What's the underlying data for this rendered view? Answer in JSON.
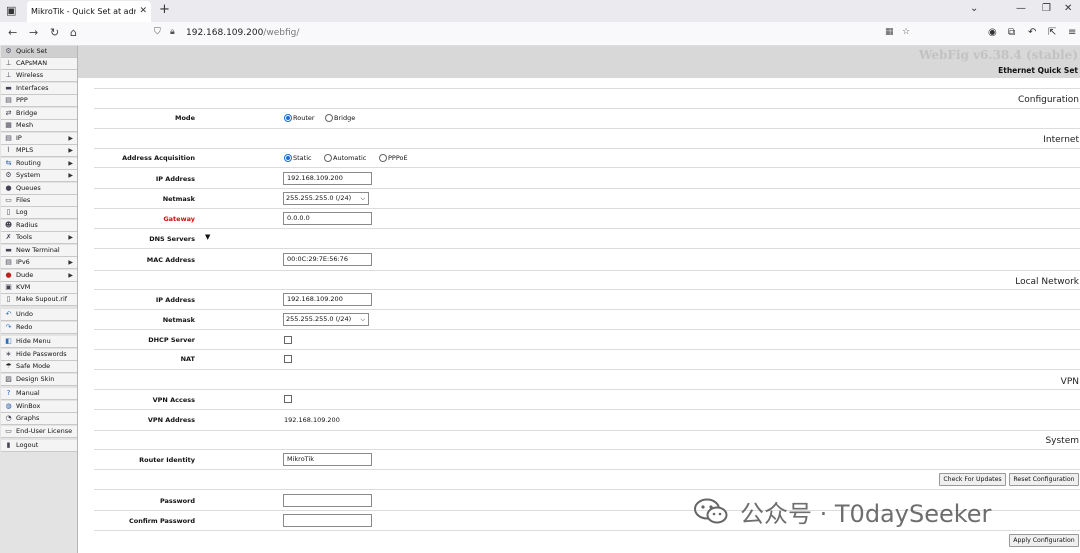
{
  "browser": {
    "tab_title": "MikroTik - Quick Set at admin@",
    "url_host": "192.168.109.200",
    "url_path": "/webfig/"
  },
  "sidebar": {
    "items": [
      {
        "label": "Quick Set",
        "icon": "quickset-icon",
        "arrow": false
      },
      {
        "label": "CAPsMAN",
        "icon": "capsman-icon",
        "arrow": false
      },
      {
        "label": "Wireless",
        "icon": "wireless-icon",
        "arrow": false
      },
      {
        "label": "Interfaces",
        "icon": "interfaces-icon",
        "arrow": false
      },
      {
        "label": "PPP",
        "icon": "ppp-icon",
        "arrow": false
      },
      {
        "label": "Bridge",
        "icon": "bridge-icon",
        "arrow": false
      },
      {
        "label": "Mesh",
        "icon": "mesh-icon",
        "arrow": false
      },
      {
        "label": "IP",
        "icon": "ip-icon",
        "arrow": true
      },
      {
        "label": "MPLS",
        "icon": "mpls-icon",
        "arrow": true
      },
      {
        "label": "Routing",
        "icon": "routing-icon",
        "arrow": true
      },
      {
        "label": "System",
        "icon": "system-icon",
        "arrow": true
      },
      {
        "label": "Queues",
        "icon": "queues-icon",
        "arrow": false
      },
      {
        "label": "Files",
        "icon": "files-icon",
        "arrow": false
      },
      {
        "label": "Log",
        "icon": "log-icon",
        "arrow": false
      },
      {
        "label": "Radius",
        "icon": "radius-icon",
        "arrow": false
      },
      {
        "label": "Tools",
        "icon": "tools-icon",
        "arrow": true
      },
      {
        "label": "New Terminal",
        "icon": "terminal-icon",
        "arrow": false
      },
      {
        "label": "IPv6",
        "icon": "ipv6-icon",
        "arrow": true
      },
      {
        "label": "Dude",
        "icon": "dude-icon",
        "arrow": true
      },
      {
        "label": "KVM",
        "icon": "kvm-icon",
        "arrow": false
      },
      {
        "label": "Make Supout.rif",
        "icon": "supout-icon",
        "arrow": false
      },
      {
        "label": "Undo",
        "icon": "undo-icon",
        "arrow": false
      },
      {
        "label": "Redo",
        "icon": "redo-icon",
        "arrow": false
      },
      {
        "label": "Hide Menu",
        "icon": "hide-menu-icon",
        "arrow": false
      },
      {
        "label": "Hide Passwords",
        "icon": "hide-passwords-icon",
        "arrow": false
      },
      {
        "label": "Safe Mode",
        "icon": "safe-mode-icon",
        "arrow": false
      },
      {
        "label": "Design Skin",
        "icon": "design-skin-icon",
        "arrow": false
      },
      {
        "label": "Manual",
        "icon": "manual-icon",
        "arrow": false
      },
      {
        "label": "WinBox",
        "icon": "winbox-icon",
        "arrow": false
      },
      {
        "label": "Graphs",
        "icon": "graphs-icon",
        "arrow": false
      },
      {
        "label": "End-User License",
        "icon": "license-icon",
        "arrow": false
      },
      {
        "label": "Logout",
        "icon": "logout-icon",
        "arrow": false
      }
    ]
  },
  "header": {
    "brand": "WebFig v6.38.4 (stable)",
    "title": "Ethernet Quick Set"
  },
  "sections": {
    "configuration": "Configuration",
    "internet": "Internet",
    "local_network": "Local Network",
    "vpn": "VPN",
    "system": "System"
  },
  "config": {
    "mode_label": "Mode",
    "mode_options": [
      "Router",
      "Bridge"
    ],
    "mode_selected": "Router"
  },
  "internet": {
    "acq_label": "Address Acquisition",
    "acq_options": [
      "Static",
      "Automatic",
      "PPPoE"
    ],
    "acq_selected": "Static",
    "ip_label": "IP Address",
    "ip_value": "192.168.109.200",
    "netmask_label": "Netmask",
    "netmask_value": "255.255.255.0 (/24)",
    "gateway_label": "Gateway",
    "gateway_value": "0.0.0.0",
    "dns_label": "DNS Servers",
    "mac_label": "MAC Address",
    "mac_value": "00:0C:29:7E:56:76"
  },
  "local": {
    "ip_label": "IP Address",
    "ip_value": "192.168.109.200",
    "netmask_label": "Netmask",
    "netmask_value": "255.255.255.0 (/24)",
    "dhcp_label": "DHCP Server",
    "nat_label": "NAT"
  },
  "vpn": {
    "access_label": "VPN Access",
    "address_label": "VPN Address",
    "address_value": "192.168.109.200"
  },
  "system": {
    "identity_label": "Router Identity",
    "identity_value": "MikroTik",
    "check_updates": "Check For Updates",
    "reset_config": "Reset Configuration",
    "password_label": "Password",
    "confirm_label": "Confirm Password",
    "apply": "Apply Configuration"
  },
  "watermark": "公众号 · T0daySeeker"
}
